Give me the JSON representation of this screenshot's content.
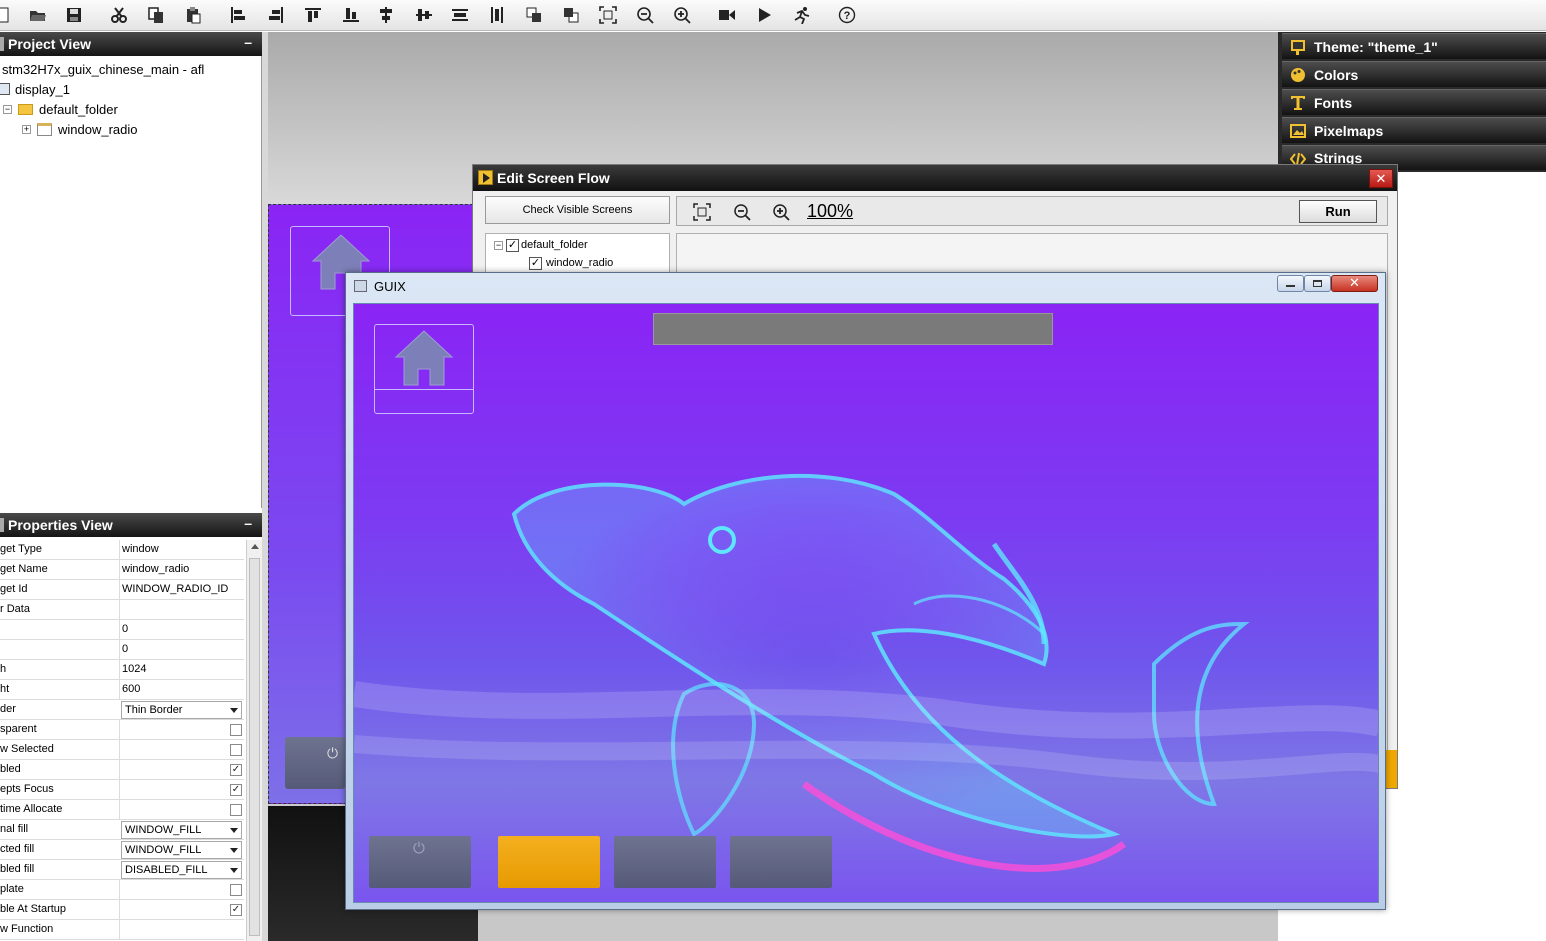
{
  "toolbar": {
    "icons": [
      "new-icon",
      "open-icon",
      "save-icon",
      "cut-icon",
      "copy-icon",
      "paste-icon",
      "align-left-icon",
      "align-right-icon",
      "align-top-icon",
      "align-bottom-icon",
      "equal-width-icon",
      "equal-height-icon",
      "hspace-icon",
      "vspace-icon",
      "move-front-icon",
      "move-back-icon",
      "size-to-fit-icon",
      "zoom-out-icon",
      "zoom-in-icon",
      "record-macro-icon",
      "play-icon",
      "run-icon",
      "help-icon"
    ]
  },
  "project_view": {
    "title": "Project View",
    "minimize": "–",
    "tree": {
      "project": "stm32H7x_guix_chinese_main - afl",
      "display": "display_1",
      "folder": "default_folder",
      "window": "window_radio"
    }
  },
  "properties_view": {
    "title": "Properties View",
    "minimize": "–",
    "rows": [
      {
        "name": "get Type",
        "value": "window",
        "kind": "text"
      },
      {
        "name": "get Name",
        "value": "window_radio",
        "kind": "text"
      },
      {
        "name": "get Id",
        "value": "WINDOW_RADIO_ID",
        "kind": "text"
      },
      {
        "name": "r Data",
        "value": "",
        "kind": "text"
      },
      {
        "name": "",
        "value": "0",
        "kind": "text"
      },
      {
        "name": "",
        "value": "0",
        "kind": "text"
      },
      {
        "name": "h",
        "value": "1024",
        "kind": "text"
      },
      {
        "name": "ht",
        "value": "600",
        "kind": "text"
      },
      {
        "name": "der",
        "value": "Thin Border",
        "kind": "combo"
      },
      {
        "name": "sparent",
        "value": "",
        "kind": "check",
        "checked": false
      },
      {
        "name": "w Selected",
        "value": "",
        "kind": "check",
        "checked": false
      },
      {
        "name": "bled",
        "value": "",
        "kind": "check",
        "checked": true
      },
      {
        "name": "epts Focus",
        "value": "",
        "kind": "check",
        "checked": true
      },
      {
        "name": "time Allocate",
        "value": "",
        "kind": "check",
        "checked": false
      },
      {
        "name": "nal fill",
        "value": "WINDOW_FILL",
        "kind": "combo"
      },
      {
        "name": "cted fill",
        "value": "WINDOW_FILL",
        "kind": "combo"
      },
      {
        "name": "bled fill",
        "value": "DISABLED_FILL",
        "kind": "combo"
      },
      {
        "name": "plate",
        "value": "",
        "kind": "check",
        "checked": false
      },
      {
        "name": "ble At Startup",
        "value": "",
        "kind": "check",
        "checked": true
      },
      {
        "name": "w Function",
        "value": "",
        "kind": "text"
      }
    ]
  },
  "theme_panel": {
    "theme": "Theme: \"theme_1\"",
    "colors": "Colors",
    "fonts": "Fonts",
    "pixelmaps": "Pixelmaps",
    "strings": "Strings"
  },
  "screen_flow": {
    "title": "Edit Screen Flow",
    "check_button": "Check Visible Screens",
    "zoom": "100%",
    "run_button": "Run",
    "tree": {
      "folder": "default_folder",
      "window": "window_radio"
    }
  },
  "guix_window": {
    "title": "GUIX"
  },
  "colors": {
    "accent_orange": "#f0a800",
    "close_red": "#c8201c",
    "purple_bg": "#7d3af2"
  }
}
